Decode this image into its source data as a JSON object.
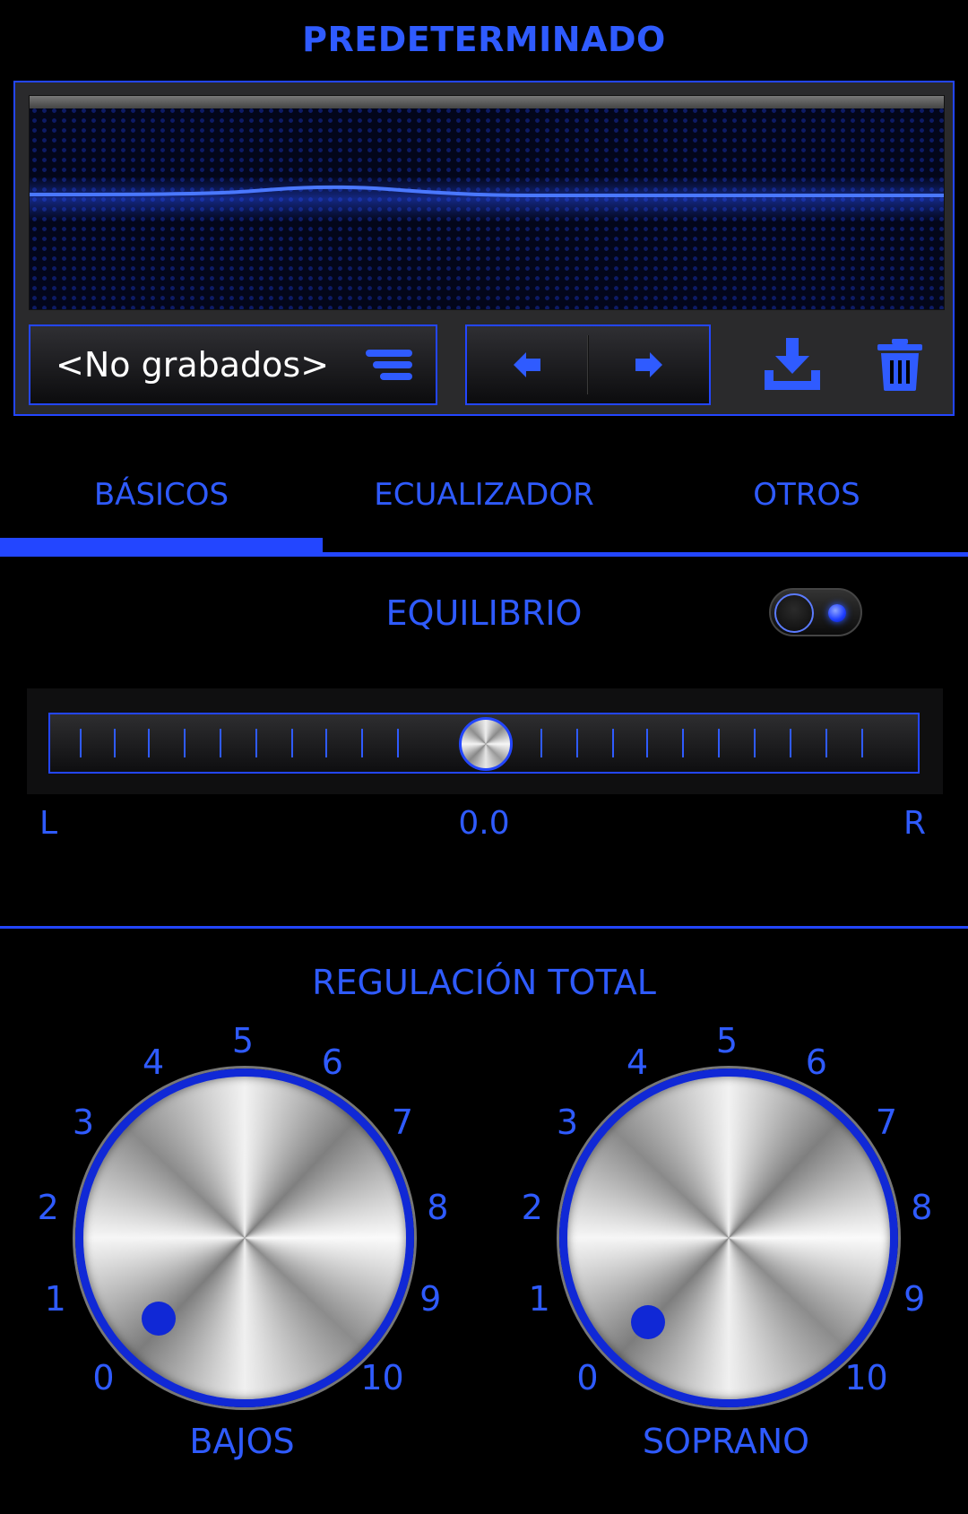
{
  "header": {
    "title": "PREDETERMINADO"
  },
  "preset": {
    "selected": "<No grabados>",
    "list_icon": "list-icon",
    "prev_icon": "arrow-left-icon",
    "next_icon": "arrow-right-icon",
    "save_icon": "download-icon",
    "delete_icon": "trash-icon"
  },
  "tabs": [
    {
      "label": "BÁSICOS",
      "active": true
    },
    {
      "label": "ECUALIZADOR",
      "active": false
    },
    {
      "label": "OTROS",
      "active": false
    }
  ],
  "balance": {
    "title": "EQUILIBRIO",
    "enabled": true,
    "left_label": "L",
    "right_label": "R",
    "value": "0.0"
  },
  "total": {
    "title": "REGULACIÓN TOTAL",
    "scale": [
      "0",
      "1",
      "2",
      "3",
      "4",
      "5",
      "6",
      "7",
      "8",
      "9",
      "10"
    ],
    "knobs": [
      {
        "label": "BAJOS",
        "value": 0.5
      },
      {
        "label": "SOPRANO",
        "value": 0.5
      }
    ]
  },
  "colors": {
    "accent": "#2f5bff",
    "background": "#000000",
    "panel": "#2a2a2c"
  }
}
